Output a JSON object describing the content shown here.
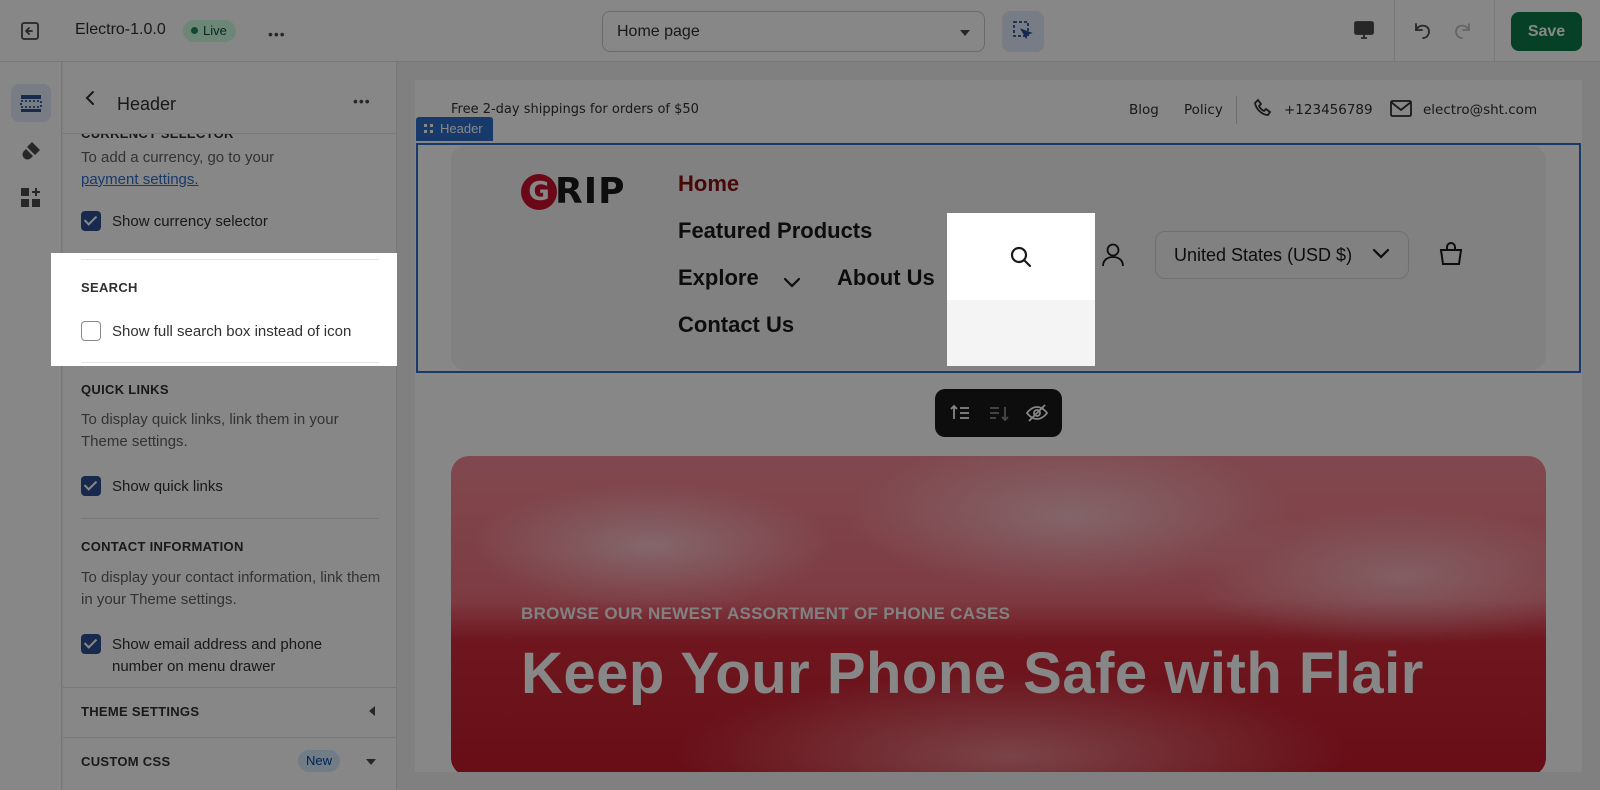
{
  "topbar": {
    "theme_name": "Electro-1.0.0",
    "live_label": "Live",
    "more_label": "•••",
    "page_select_value": "Home page",
    "save_label": "Save"
  },
  "panel": {
    "title": "Header",
    "more_label": "•••",
    "section_cut_title": "CURRENCY SELECTOR",
    "currency_help": "To add a currency, go to your",
    "currency_help_link": "payment settings.",
    "show_currency_selector": "Show currency selector",
    "search_title": "SEARCH",
    "show_full_search": "Show full search box instead of icon",
    "quick_links_title": "QUICK LINKS",
    "quick_links_help": "To display quick links, link them in your Theme settings.",
    "show_quick_links": "Show quick links",
    "contact_title": "CONTACT INFORMATION",
    "contact_help": "To display your contact information, link them in your Theme settings.",
    "show_contact_line1": "Show email address and phone",
    "show_contact_line2": "number on menu drawer",
    "theme_settings": "THEME SETTINGS",
    "custom_css": "CUSTOM CSS",
    "new_badge": "New",
    "checkboxes": {
      "currency": true,
      "full_search": false,
      "quick_links": true,
      "contact": true
    }
  },
  "preview": {
    "announcement": "Free 2-day shippings for orders of $50",
    "links": [
      "Blog",
      "Policy"
    ],
    "phone": "+123456789",
    "email": "electro@sht.com",
    "header_tag": "Header",
    "logo_letter": "G",
    "logo_rest": "RIP",
    "nav": {
      "home": "Home",
      "featured": "Featured Products",
      "explore": "Explore",
      "about": "About Us",
      "contact": "Contact Us"
    },
    "currency_selector": "United States (USD $)",
    "hero_eyebrow": "BROWSE OUR NEWEST ASSORTMENT OF PHONE CASES",
    "hero_title": "Keep Your Phone Safe with Flair"
  },
  "colors": {
    "accent": "#2c6ecb",
    "save": "#0d7a48",
    "active_nav": "#8b1010",
    "hero_red": "#c41a2b"
  }
}
